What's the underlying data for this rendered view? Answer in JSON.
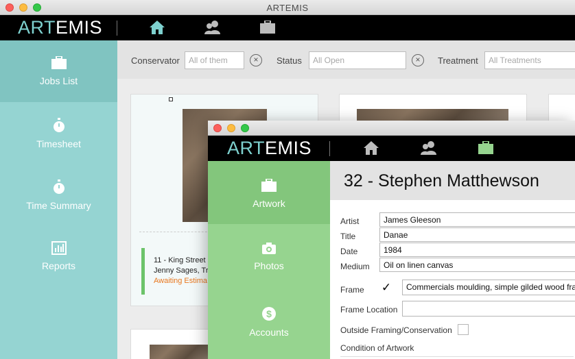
{
  "main_window": {
    "title": "ARTEMIS",
    "brand": {
      "part1": "ART",
      "part2": "EMIS"
    },
    "sidebar": [
      {
        "label": "Jobs List",
        "icon": "briefcase-icon"
      },
      {
        "label": "Timesheet",
        "icon": "stopwatch-icon"
      },
      {
        "label": "Time Summary",
        "icon": "stopwatch-icon"
      },
      {
        "label": "Reports",
        "icon": "bar-chart-icon"
      }
    ],
    "filters": {
      "conservator_label": "Conservator",
      "conservator_placeholder": "All of them",
      "status_label": "Status",
      "status_placeholder": "All Open",
      "treatment_label": "Treatment",
      "treatment_placeholder": "All Treatments"
    },
    "job_card": {
      "line1": "11 - King Street",
      "line2": "Jenny Sages, Tri",
      "status": "Awaiting Estima"
    }
  },
  "detail_window": {
    "brand": {
      "part1": "ART",
      "part2": "EMIS"
    },
    "sidebar": [
      {
        "label": "Artwork",
        "icon": "briefcase-icon"
      },
      {
        "label": "Photos",
        "icon": "camera-icon"
      },
      {
        "label": "Accounts",
        "icon": "dollar-icon"
      }
    ],
    "heading": "32 - Stephen Matthewson",
    "fields": {
      "artist_label": "Artist",
      "artist_value": "James Gleeson",
      "title_label": "Title",
      "title_value": "Danae",
      "date_label": "Date",
      "date_value": "1984",
      "medium_label": "Medium",
      "medium_value": "Oil on linen canvas",
      "frame_label": "Frame",
      "frame_check": "✓",
      "frame_value": "Commercials moulding, simple gilded wood fra",
      "frame_location_label": "Frame Location",
      "outside_label": "Outside Framing/Conservation",
      "condition_label": "Condition of Artwork"
    }
  },
  "colors": {
    "teal": "#95d4d2",
    "teal_active": "#80c4c1",
    "green": "#96d48f",
    "green_active": "#83c67c",
    "status_orange": "#e8761d"
  }
}
